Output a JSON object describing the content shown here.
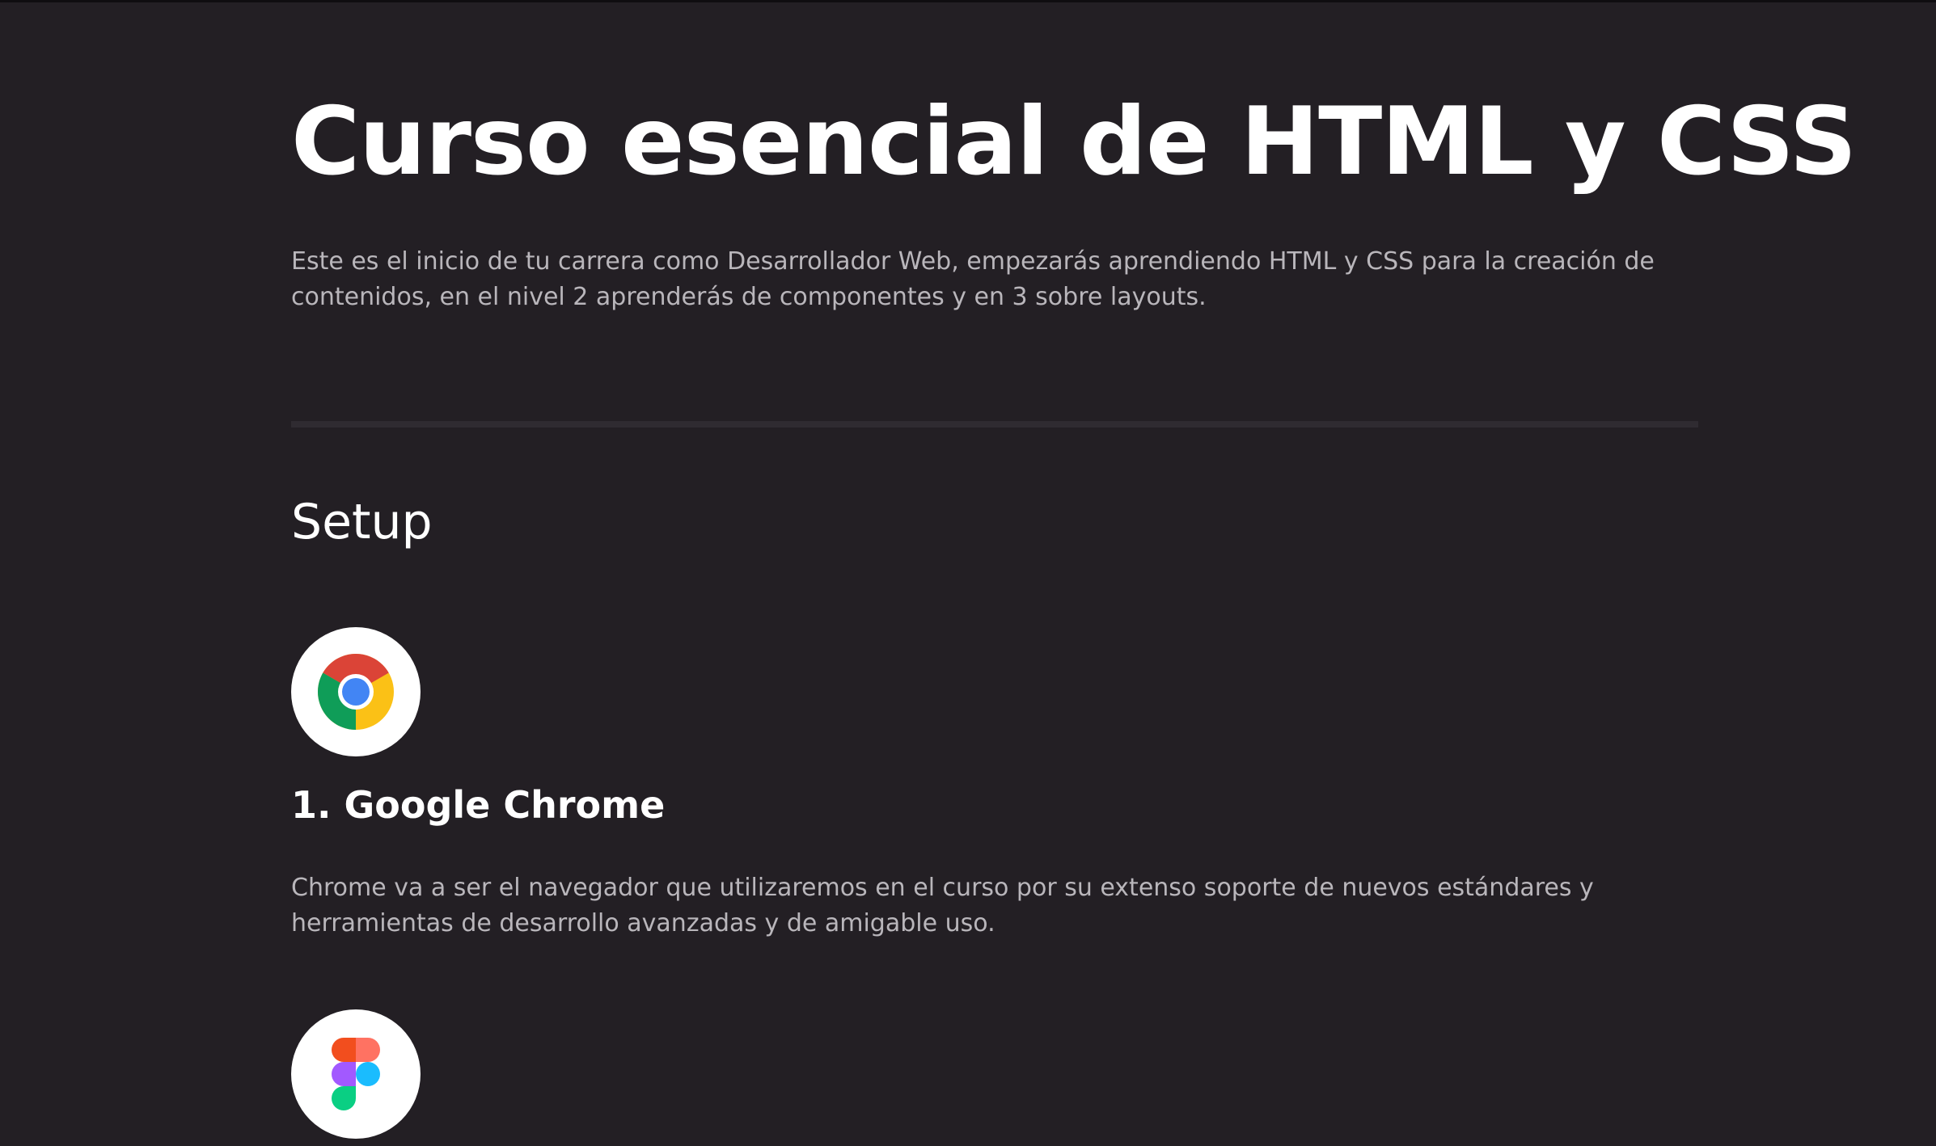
{
  "page": {
    "title": "Curso esencial de HTML y CSS",
    "intro": "Este es el inicio de tu carrera como Desarrollador Web, empezarás aprendiendo HTML y CSS para la creación de contenidos, en el nivel 2 aprenderás de componentes y en 3 sobre layouts."
  },
  "setup": {
    "title": "Setup",
    "items": [
      {
        "title": "1. Google Chrome",
        "description": "Chrome va a ser el navegador que utilizaremos en el curso por su extenso soporte de nuevos estándares y herramientas de desarrollo avanzadas y de amigable uso.",
        "icon": "chrome-icon"
      },
      {
        "icon": "figma-icon"
      }
    ]
  },
  "colors": {
    "background": "#231f24",
    "text_primary": "#ffffff",
    "text_secondary": "#b9b6bb",
    "divider": "#2f2b31"
  }
}
